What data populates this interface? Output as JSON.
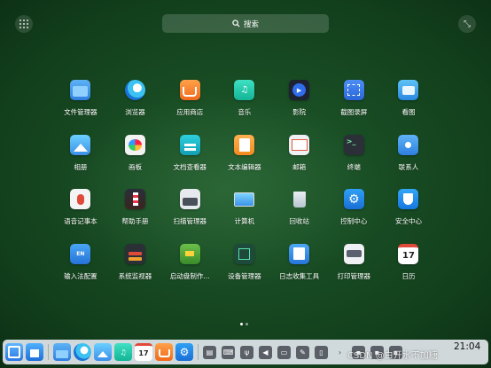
{
  "search": {
    "label": "搜索"
  },
  "apps": [
    {
      "label": "文件管理器",
      "icon": "folder-icon"
    },
    {
      "label": "浏览器",
      "icon": "browser-icon"
    },
    {
      "label": "应用商店",
      "icon": "store-icon"
    },
    {
      "label": "音乐",
      "icon": "music-icon"
    },
    {
      "label": "影院",
      "icon": "video-icon"
    },
    {
      "label": "截图录屏",
      "icon": "screenshot-icon"
    },
    {
      "label": "看图",
      "icon": "image-viewer-icon"
    },
    {
      "label": "相册",
      "icon": "album-icon"
    },
    {
      "label": "画板",
      "icon": "paint-icon"
    },
    {
      "label": "文档查看器",
      "icon": "document-viewer-icon"
    },
    {
      "label": "文本编辑器",
      "icon": "text-editor-icon"
    },
    {
      "label": "邮箱",
      "icon": "mail-icon"
    },
    {
      "label": "终端",
      "icon": "terminal-icon"
    },
    {
      "label": "联系人",
      "icon": "contacts-icon"
    },
    {
      "label": "语音记事本",
      "icon": "voice-note-icon"
    },
    {
      "label": "帮助手册",
      "icon": "help-icon"
    },
    {
      "label": "扫描管理器",
      "icon": "scanner-icon"
    },
    {
      "label": "计算机",
      "icon": "computer-icon"
    },
    {
      "label": "回收站",
      "icon": "trash-icon"
    },
    {
      "label": "控制中心",
      "icon": "settings-icon"
    },
    {
      "label": "安全中心",
      "icon": "security-icon"
    },
    {
      "label": "输入法配置",
      "icon": "keyboard-icon"
    },
    {
      "label": "系统监视器",
      "icon": "monitor-icon"
    },
    {
      "label": "启动盘制作...",
      "icon": "boot-maker-icon"
    },
    {
      "label": "设备管理器",
      "icon": "device-manager-icon"
    },
    {
      "label": "日志收集工具",
      "icon": "log-icon"
    },
    {
      "label": "打印管理器",
      "icon": "printer-icon"
    },
    {
      "label": "日历",
      "icon": "calendar-icon",
      "badge": "17"
    }
  ],
  "dock": {
    "calendar_badge": "17",
    "clock": "21:04"
  },
  "watermark": "CSDN @白开水不加糖"
}
